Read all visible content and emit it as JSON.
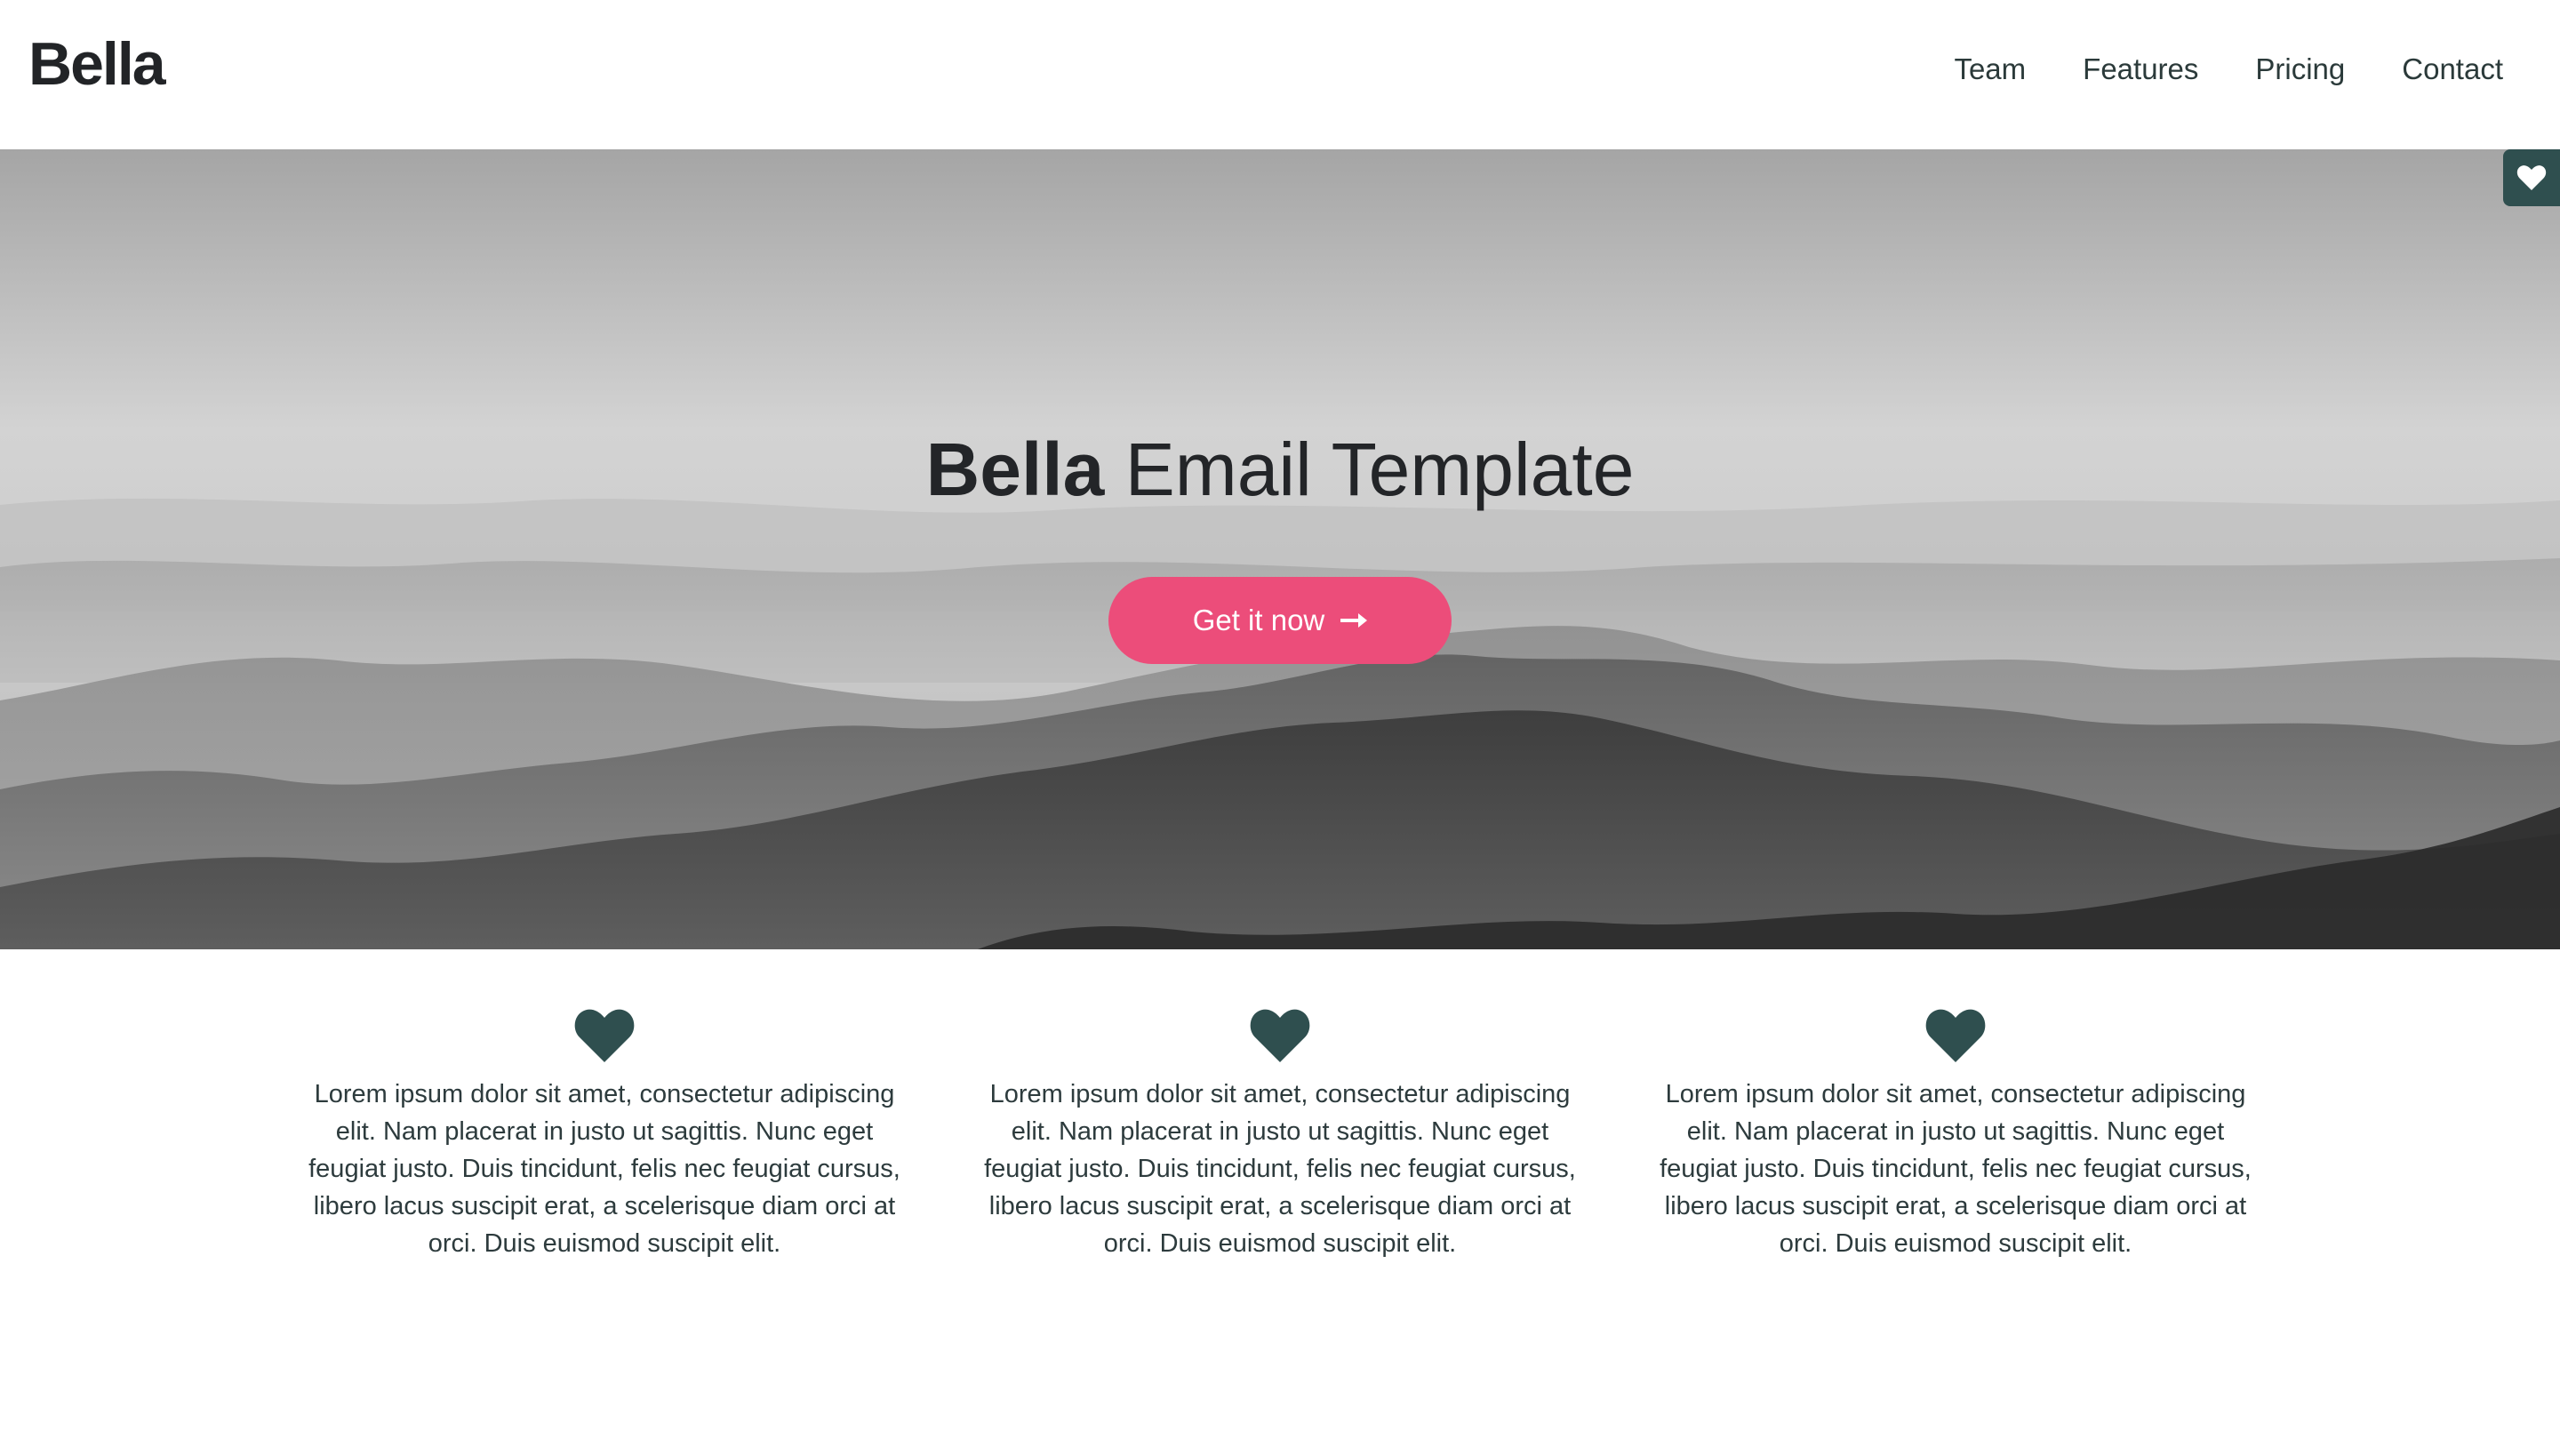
{
  "header": {
    "logo": "Bella",
    "nav": [
      "Team",
      "Features",
      "Pricing",
      "Contact"
    ]
  },
  "hero": {
    "title_bold": "Bella",
    "title_rest": "Email Template",
    "cta_label": "Get it now",
    "cta_icon": "arrow-right-icon"
  },
  "side_tab": {
    "icon": "heart-icon"
  },
  "features": [
    {
      "icon": "heart-icon",
      "text": "Lorem ipsum dolor sit amet, consectetur adipiscing elit. Nam placerat in justo ut sagittis. Nunc eget feugiat justo. Duis tincidunt, felis nec feugiat cursus, libero lacus suscipit erat, a scelerisque diam orci at orci. Duis euismod suscipit elit."
    },
    {
      "icon": "heart-icon",
      "text": "Lorem ipsum dolor sit amet, consectetur adipiscing elit. Nam placerat in justo ut sagittis. Nunc eget feugiat justo. Duis tincidunt, felis nec feugiat cursus, libero lacus suscipit erat, a scelerisque diam orci at orci. Duis euismod suscipit elit."
    },
    {
      "icon": "heart-icon",
      "text": "Lorem ipsum dolor sit amet, consectetur adipiscing elit. Nam placerat in justo ut sagittis. Nunc eget feugiat justo. Duis tincidunt, felis nec feugiat cursus, libero lacus suscipit erat, a scelerisque diam orci at orci. Duis euismod suscipit elit."
    }
  ],
  "colors": {
    "accent": "#ec4d7a",
    "icon": "#2f4f4f",
    "text": "#2d3b3d"
  }
}
